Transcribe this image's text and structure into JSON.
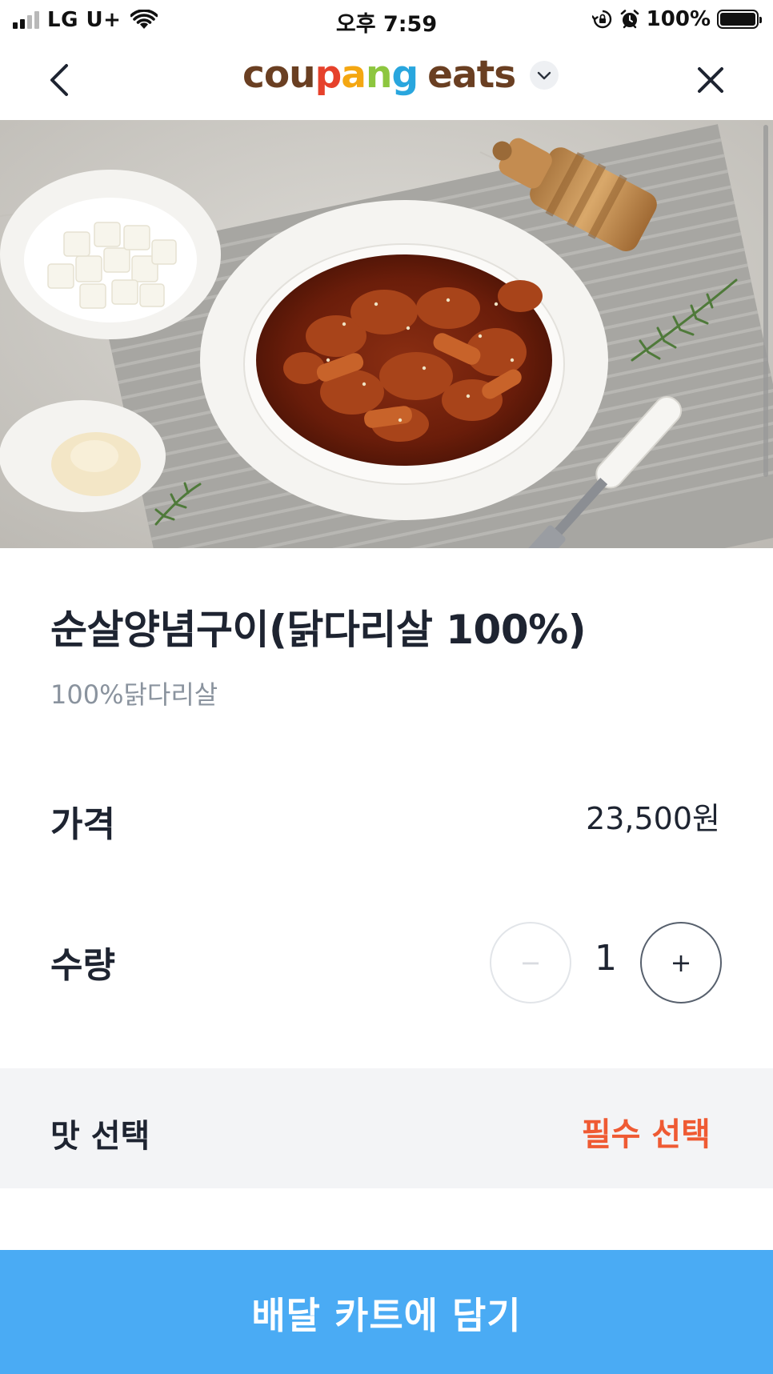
{
  "status_bar": {
    "carrier": "LG U+",
    "time": "오후 7:59",
    "battery": "100%"
  },
  "nav": {
    "brand_first": "coupang",
    "brand_second": "eats"
  },
  "product": {
    "name": "순살양념구이(닭다리살 100%)",
    "description": "100%닭다리살",
    "price_label": "가격",
    "price_value": "23,500원",
    "quantity_label": "수량",
    "quantity_value": "1",
    "minus_symbol": "−",
    "plus_symbol": "+"
  },
  "options": {
    "label": "맛 선택",
    "required": "필수 선택"
  },
  "cta": {
    "label": "배달 카트에 담기"
  },
  "colors": {
    "cta_bg": "#4aabf4",
    "required_text": "#ef5a33",
    "option_bg": "#f3f4f6",
    "subtext": "#8a939e"
  }
}
